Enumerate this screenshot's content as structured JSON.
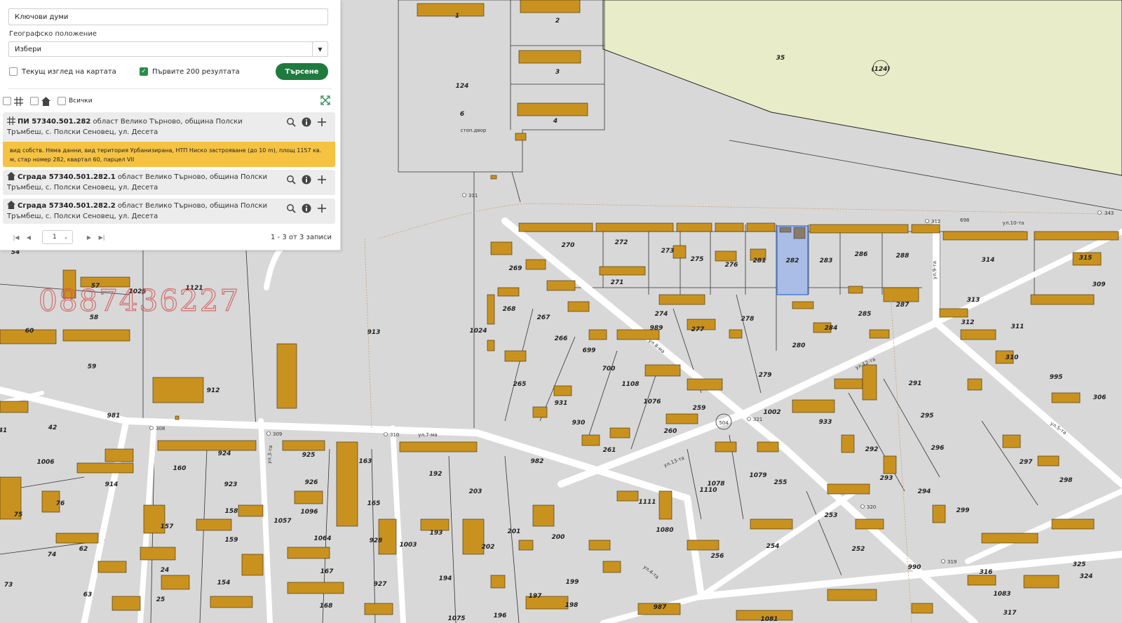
{
  "search": {
    "keywords_value": "Ключови думи",
    "geo_label": "Географско положение",
    "geo_select_value": "Избери",
    "current_view_label": "Текущ изглед на картата",
    "first_200_label": "Първите 200 резултата",
    "search_button": "Търсене",
    "filter_all_label": "Всички"
  },
  "results": [
    {
      "type_icon": "parcel-grid-icon",
      "title": "ПИ 57340.501.282",
      "address": " област Велико Търново, община Полски Тръмбеш, с. Полски Сеновец, ул. Десета",
      "details": "вид собств. Няма данни, вид територия Урбанизирана, НТП Ниско застрояване (до 10 m), площ 1157 кв. м, стар номер 282, квартал 60, парцел VII"
    },
    {
      "type_icon": "building-icon",
      "title": "Сграда 57340.501.282.1",
      "address": " област Велико Търново, община Полски Тръмбеш, с. Полски Сеновец, ул. Десета"
    },
    {
      "type_icon": "building-icon",
      "title": "Сграда 57340.501.282.2",
      "address": " област Велико Търново, община Полски Тръмбеш, с. Полски Сеновец, ул. Десета"
    }
  ],
  "pager": {
    "page": "1",
    "count_text": "1 - 3 от 3 записи"
  },
  "map": {
    "watermark": "0887436227",
    "colors": {
      "land": "#d8d8d8",
      "field": "#e8ecc8",
      "building": "#c9921f",
      "road": "#ffffff",
      "selected": "#a9bde6"
    },
    "parcel_labels": [
      "1",
      "2",
      "3",
      "4",
      "6",
      "124",
      "35",
      "(124)",
      "270",
      "272",
      "273",
      "275",
      "276",
      "281",
      "282",
      "283",
      "286",
      "288",
      "314",
      "315",
      "309",
      "269",
      "271",
      "274",
      "277",
      "278",
      "285",
      "287",
      "313",
      "312",
      "311",
      "268",
      "267",
      "266",
      "699",
      "700",
      "1108",
      "1076",
      "989",
      "280",
      "284",
      "279",
      "259",
      "260",
      "261",
      "1002",
      "933",
      "291",
      "295",
      "296",
      "297",
      "298",
      "310",
      "306",
      "995",
      "265",
      "931",
      "930",
      "913",
      "1024",
      "912",
      "1121",
      "1025",
      "57",
      "58",
      "60",
      "59",
      "54",
      "41",
      "42",
      "981",
      "1006",
      "914",
      "75",
      "76",
      "74",
      "62",
      "63",
      "73",
      "160",
      "924",
      "923",
      "158",
      "159",
      "157",
      "154",
      "24",
      "25",
      "925",
      "926",
      "1096",
      "1064",
      "167",
      "168",
      "163",
      "165",
      "928",
      "927",
      "1003",
      "192",
      "203",
      "193",
      "202",
      "201",
      "200",
      "194",
      "197",
      "198",
      "196",
      "199",
      "982",
      "1111",
      "1080",
      "1110",
      "1078",
      "1079",
      "255",
      "256",
      "254",
      "253",
      "252",
      "292",
      "293",
      "294",
      "299",
      "325",
      "316",
      "324",
      "1083",
      "317",
      "990",
      "987",
      "1057",
      "1075",
      "1081"
    ],
    "street_labels": [
      "ул.7-ма",
      "ул.8-ма",
      "ул.12-та",
      "ул.13-та",
      "ул.10-та",
      "ул.9-та",
      "ул.5-та",
      "ул.3-та",
      "ул.4-та",
      "стоп.двор"
    ],
    "point_labels": [
      "311",
      "312",
      "308",
      "309",
      "310",
      "321",
      "320",
      "319",
      "698",
      "343",
      "504"
    ]
  }
}
